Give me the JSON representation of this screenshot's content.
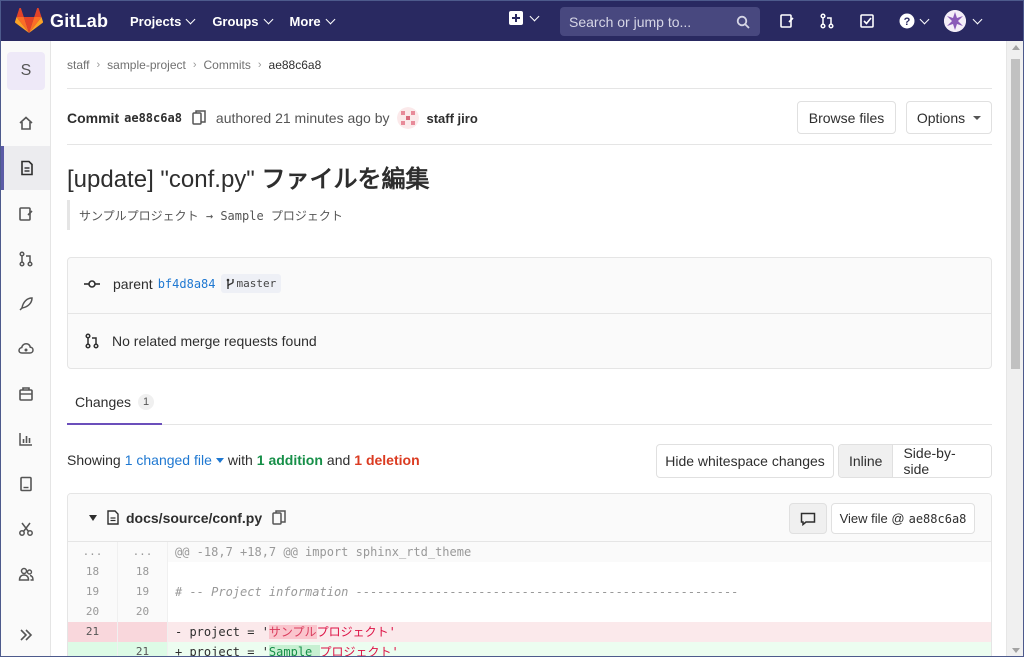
{
  "navbar": {
    "brand": "GitLab",
    "menu": [
      "Projects",
      "Groups",
      "More"
    ],
    "search_placeholder": "Search or jump to..."
  },
  "sidebar": {
    "project_initial": "S",
    "items": [
      "home-icon",
      "repository-icon",
      "issues-icon",
      "merge-requests-icon",
      "ci-cd-icon",
      "operations-icon",
      "packages-icon",
      "analytics-icon",
      "wiki-icon",
      "snippets-icon",
      "members-icon",
      "collapse-icon"
    ]
  },
  "breadcrumb": [
    "staff",
    "sample-project",
    "Commits",
    "ae88c6a8"
  ],
  "commit": {
    "label": "Commit",
    "sha": "ae88c6a8",
    "authored": "authored 21 minutes ago by",
    "author": "staff jiro",
    "browse_files": "Browse files",
    "options": "Options",
    "title_prefix": "[update] \"conf.py\" ",
    "title_jp": "ファイルを編集",
    "description": "サンプルプロジェクト → Sample プロジェクト"
  },
  "info": {
    "parent_label": "parent",
    "parent_sha": "bf4d8a84",
    "branch": "master",
    "merge_requests": "No related merge requests found"
  },
  "tabs": [
    {
      "label": "Changes",
      "count": "1"
    }
  ],
  "stats": {
    "showing": "Showing",
    "changed": "1 changed file",
    "with": "with",
    "additions": "1 addition",
    "and": "and",
    "deletions": "1 deletion"
  },
  "diff_controls": {
    "whitespace": "Hide whitespace changes",
    "inline": "Inline",
    "side_by_side": "Side-by-side"
  },
  "file": {
    "path": "docs/source/conf.py",
    "view_file": "View file @",
    "view_sha": "ae88c6a8"
  },
  "diff_lines": {
    "match": {
      "old": "...",
      "new": "...",
      "code": "@@ -18,7 +18,7 @@ import sphinx_rtd_theme"
    },
    "l18": {
      "old": "18",
      "new": "18",
      "code": ""
    },
    "l19": {
      "old": "19",
      "new": "19",
      "code": "# -- Project information -----------------------------------------------------"
    },
    "l20": {
      "old": "20",
      "new": "20",
      "code": ""
    },
    "del": {
      "old": "21",
      "new": "",
      "prefix": "- project = '",
      "hl": "サンプル",
      "rest": "プロジェクト'"
    },
    "add": {
      "old": "",
      "new": "21",
      "prefix": "+ project = '",
      "hl": "Sample ",
      "rest": "プロジェクト'"
    }
  },
  "colors": {
    "navbar": "#292961",
    "link": "#1f78d1",
    "addition": "#168f48",
    "deletion": "#db3b21"
  }
}
